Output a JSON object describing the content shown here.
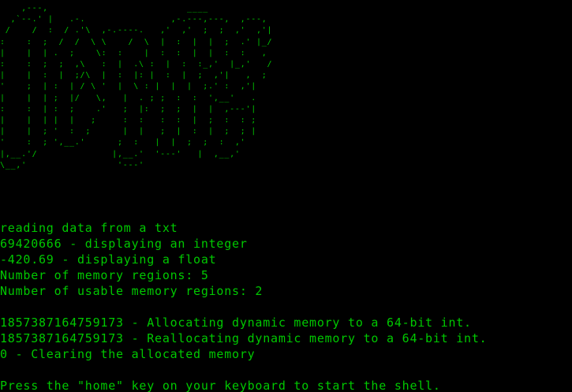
{
  "screen": {
    "background": "#000000",
    "foreground": "#00c800"
  },
  "logo_ascii": "    ,---,                          ____\n  ,`--.' |   .-.                ,-.---,---,  ,---,\n /    /  :  / .'\\  ,-.----.   ,'  ,'  ;  ;  ,'  ,'|\n:    :  ;  /  /  \\ \\    /  \\  |  :  |  |  ;  .' |_/\n|    |  | .  ;    \\:  :    |  :  :  |  |  :  :   ,\n:    :  ;  ;  ,\\   :  |  .\\ :  |  :  :_,'  |_,'   /\n|    |  :  |  ;/\\  |  :  |: |  :  |  ;  ,'|   ,  ;\n'    ;  | :  | / \\ '  |  \\ : |  |  |  ;.' :  ,'|\n|    |  | ;  |/   \\,   |  . ; ;  :  :  ',__'   .\n:    :  | :  ;    .'   ;  |:  ;  ;  |  |  ,---'|\n|    |  | |  |   ;     :  :   :  :  |  ;  :  : ;\n|    |  ; '  :  ;      |  |   ;  |  :  |  ;  ; |\n'    :  ; ',__.'      ;  :   |  |  ;  ;  :  ,'\n|,__.'/              |,__.'  '---'   |  ,__,'\n\\__,'                 '---'",
  "lines": [
    "reading data from a txt",
    "69420666 - displaying an integer",
    "-420.69 - displaying a float",
    "Number of memory regions: 5",
    "Number of usable memory regions: 2",
    "",
    "1857387164759173 - Allocating dynamic memory to a 64-bit int.",
    "1857387164759173 - Reallocating dynamic memory to a 64-bit int.",
    "0 - Clearing the allocated memory",
    "",
    "Press the \"home\" key on your keyboard to start the shell."
  ]
}
